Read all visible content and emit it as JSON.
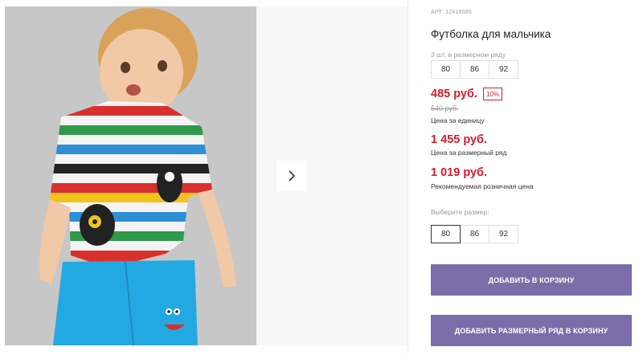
{
  "gallery": {
    "next_icon": "chevron-right-icon",
    "photo_alt": "Boy in striped T-shirt with monster print"
  },
  "product": {
    "article": "АРТ: 12419085",
    "title": "Футболка для мальчика",
    "pack_caption": "3 шт. в размерном ряду",
    "pack_sizes": [
      "80",
      "86",
      "92"
    ],
    "unit_price": "485 руб.",
    "discount": "10%",
    "old_price": "540 руб.",
    "unit_price_note": "Цена за единицу",
    "pack_price": "1 455 руб.",
    "pack_price_note": "Цена за размерный ряд",
    "retail_price": "1 019 руб.",
    "retail_price_note": "Рекомендуемая розничная цена",
    "size_select_caption": "Выберите размер:",
    "size_options": [
      "80",
      "86",
      "92"
    ],
    "selected_size": "80",
    "add_to_cart": "ДОБАВИТЬ В КОРЗИНУ",
    "add_pack_to_cart": "ДОБАВИТЬ РАЗМЕРНЫЙ РЯД В КОРЗИНУ"
  },
  "colors": {
    "price_red": "#d41c2c",
    "button_purple": "#7b6da8"
  }
}
